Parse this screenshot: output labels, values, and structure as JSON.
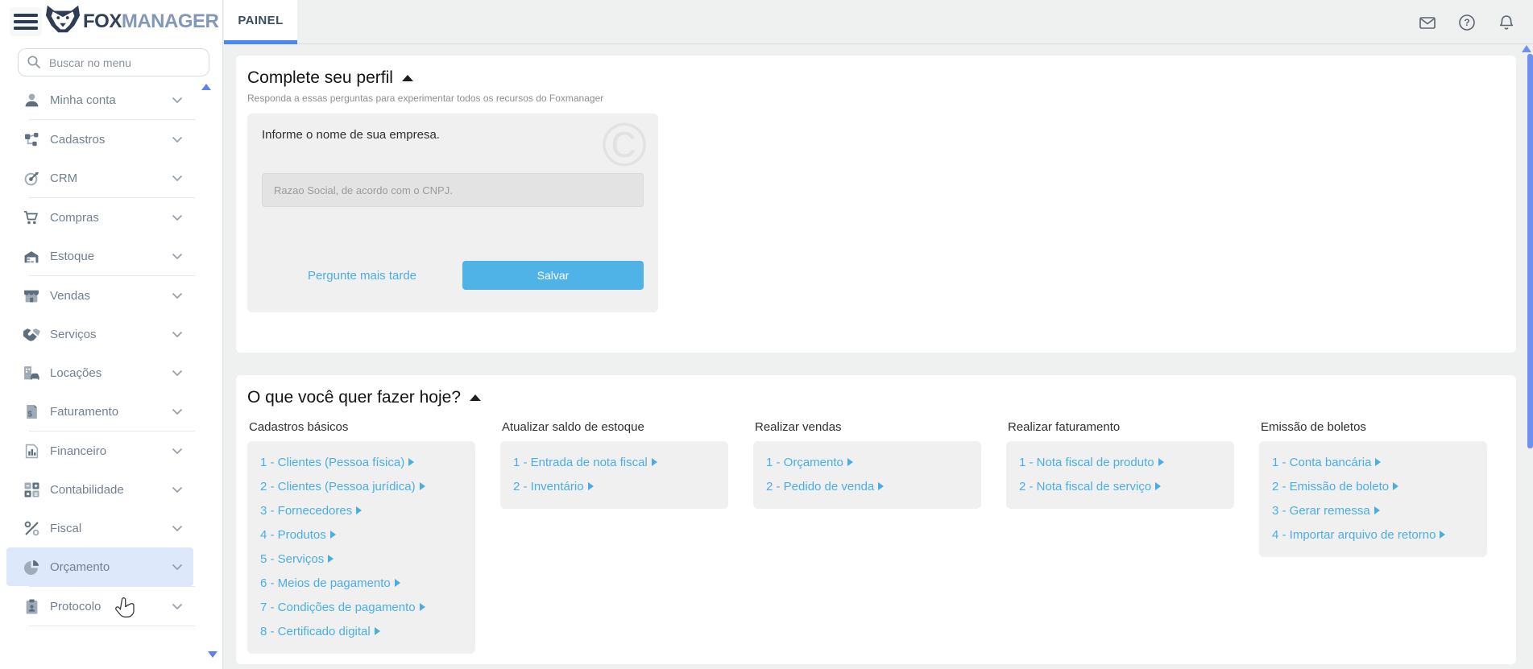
{
  "brand": {
    "logo_text_primary": "FOX",
    "logo_text_secondary": "MANAGER"
  },
  "topbar": {
    "tab": "PAINEL",
    "icons": [
      "mail",
      "help",
      "notifications"
    ]
  },
  "sidebar": {
    "search_placeholder": "Buscar no menu",
    "groups": [
      [
        {
          "icon": "user",
          "label": "Minha conta"
        }
      ],
      [
        {
          "icon": "sitemap",
          "label": "Cadastros"
        },
        {
          "icon": "target",
          "label": "CRM"
        }
      ],
      [
        {
          "icon": "cart",
          "label": "Compras"
        },
        {
          "icon": "warehouse",
          "label": "Estoque"
        }
      ],
      [
        {
          "icon": "store",
          "label": "Vendas"
        },
        {
          "icon": "handshake",
          "label": "Serviços"
        },
        {
          "icon": "building-car",
          "label": "Locações"
        },
        {
          "icon": "invoice",
          "label": "Faturamento"
        }
      ],
      [
        {
          "icon": "chart",
          "label": "Financeiro"
        },
        {
          "icon": "calculator",
          "label": "Contabilidade"
        },
        {
          "icon": "percent",
          "label": "Fiscal"
        },
        {
          "icon": "pie",
          "label": "Orçamento",
          "hovered": true
        }
      ],
      [
        {
          "icon": "clipboard",
          "label": "Protocolo"
        }
      ]
    ]
  },
  "profile_card": {
    "title": "Complete seu perfil",
    "subtitle": "Responda a essas perguntas para experimentar todos os recursos do Foxmanager",
    "question": "Informe o nome de sua empresa.",
    "input_placeholder": "Razao Social, de acordo com o CNPJ.",
    "later_link": "Pergunte mais tarde",
    "save_button": "Salvar",
    "watermark": "©"
  },
  "tasks_card": {
    "title": "O que você quer fazer hoje?",
    "columns": [
      {
        "header": "Cadastros básicos",
        "links": [
          "1 - Clientes (Pessoa física)",
          "2 - Clientes (Pessoa jurídica)",
          "3 - Fornecedores",
          "4 - Produtos",
          "5 - Serviços",
          "6 - Meios de pagamento",
          "7 - Condições de pagamento",
          "8 - Certificado digital"
        ]
      },
      {
        "header": "Atualizar saldo de estoque",
        "links": [
          "1 - Entrada de nota fiscal",
          "2 - Inventário"
        ]
      },
      {
        "header": "Realizar vendas",
        "links": [
          "1 - Orçamento",
          "2 - Pedido de venda"
        ]
      },
      {
        "header": "Realizar faturamento",
        "links": [
          "1 - Nota fiscal de produto",
          "2 - Nota fiscal de serviço"
        ]
      },
      {
        "header": "Emissão de boletos",
        "links": [
          "1 - Conta bancária",
          "2 - Emissão de boleto",
          "3 - Gerar remessa",
          "4 - Importar arquivo de retorno"
        ]
      }
    ]
  },
  "colors": {
    "accent_link_blue": "#4aaee6",
    "save_button_blue": "#4fb3e8",
    "tab_underline_blue": "#4b87f2",
    "hover_row_blue": "#dde8fb",
    "scrollbar_blue": "#6d90f2",
    "logo_dark": "#32415a",
    "logo_light": "#8298ba"
  }
}
